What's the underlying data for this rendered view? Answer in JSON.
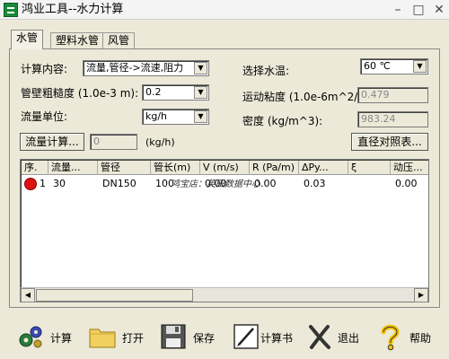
{
  "window": {
    "title": "鸿业工具--水力计算"
  },
  "title_buttons": {
    "minimize": "–",
    "maximize": "□",
    "close": "✕"
  },
  "tabs": [
    {
      "label": "水管",
      "active": true
    },
    {
      "label": "塑料水管",
      "active": false
    },
    {
      "label": "风管",
      "active": false
    }
  ],
  "form": {
    "calc_content_label": "计算内容:",
    "calc_content_value": "流量,管径->流速,阻力",
    "roughness_label": "管壁粗糙度 (1.0e-3 m):",
    "roughness_value": "0.2",
    "flow_unit_label": "流量单位:",
    "flow_unit_value": "kg/h",
    "flow_calc_button": "流量计算...",
    "flow_value": "0",
    "flow_value_unit": "(kg/h)",
    "water_temp_label": "选择水温:",
    "water_temp_value": "60 ℃",
    "viscosity_label": "运动粘度 (1.0e-6m^2/s):",
    "viscosity_value": "0.479",
    "density_label": "密度 (kg/m^3):",
    "density_value": "983.24",
    "diameter_table_button": "直径对照表..."
  },
  "table": {
    "columns": [
      "序.",
      "流量...",
      "管径",
      "管长(m)",
      "V (m/s)",
      "R (Pa/m)",
      "ΔPy...",
      "ξ",
      "动压..."
    ],
    "rows": [
      {
        "index": "1",
        "flow": "30",
        "diameter": "DN150",
        "length": "100",
        "velocity": "0.00",
        "r": "0.00",
        "dpy": "0.03",
        "xi": "",
        "dynamic": "0.00"
      }
    ]
  },
  "watermark": "鸿宝店：英田数据中心",
  "toolbar": [
    {
      "label": "计算",
      "icon": "gears-icon"
    },
    {
      "label": "打开",
      "icon": "folder-icon"
    },
    {
      "label": "保存",
      "icon": "floppy-disk-icon"
    },
    {
      "label": "计算书",
      "icon": "report-pen-icon"
    },
    {
      "label": "退出",
      "icon": "exit-x-icon"
    },
    {
      "label": "帮助",
      "icon": "help-question-icon"
    }
  ],
  "colors": {
    "accent": "#1a8a3a",
    "stop": "#d11111",
    "help": "#f2c200"
  }
}
